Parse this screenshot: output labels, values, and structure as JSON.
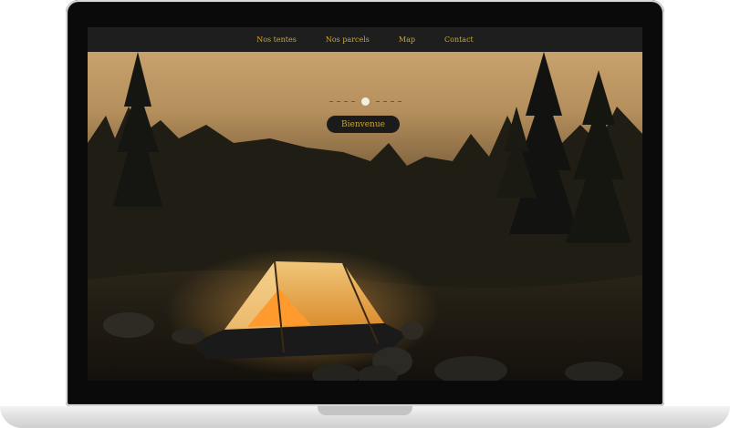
{
  "nav": {
    "items": [
      {
        "label": "Nos tentes"
      },
      {
        "label": "Nos parcels"
      },
      {
        "label": "Map"
      },
      {
        "label": "Contact"
      }
    ]
  },
  "hero": {
    "button_label": "Bienvenue",
    "carousel_active_index": 0
  },
  "colors": {
    "accent": "#c9a733",
    "navbar_bg": "#1e1e1e",
    "button_bg": "#1b1b1b"
  }
}
